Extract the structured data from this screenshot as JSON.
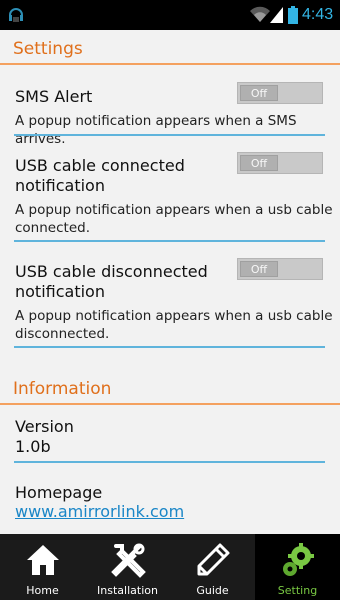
{
  "status_bar": {
    "time": "4:43",
    "icons": [
      "headset-icon",
      "wifi-icon",
      "signal-icon",
      "battery-icon"
    ]
  },
  "settings_section": {
    "title": "Settings",
    "items": [
      {
        "label": "SMS Alert",
        "description": "A popup notification appears when a SMS arrives.",
        "toggle": "Off"
      },
      {
        "label_line1": "USB cable connected",
        "label_line2": "notification",
        "description_line1": "A popup notification appears when a usb cable",
        "description_line2": "connected.",
        "toggle": "Off"
      },
      {
        "label_line1": "USB cable disconnected",
        "label_line2": "notification",
        "description_line1": "A popup notification appears when a usb cable",
        "description_line2": "disconnected.",
        "toggle": "Off"
      }
    ]
  },
  "information_section": {
    "title": "Information",
    "version_label": "Version",
    "version_value": "1.0b",
    "homepage_label": "Homepage",
    "homepage_value": "www.amirrorlink.com"
  },
  "bottom_nav": {
    "items": [
      {
        "label": "Home",
        "icon": "house-icon"
      },
      {
        "label": "Installation",
        "icon": "tools-icon"
      },
      {
        "label": "Guide",
        "icon": "pencil-icon"
      },
      {
        "label": "Setting",
        "icon": "gears-icon"
      }
    ],
    "active": "Setting"
  },
  "colors": {
    "header_orange": "#e0701c",
    "divider_blue": "#5fb4dc",
    "link_blue": "#1a86c7",
    "active_green": "#79c843",
    "clock_blue": "#33b5e5"
  }
}
